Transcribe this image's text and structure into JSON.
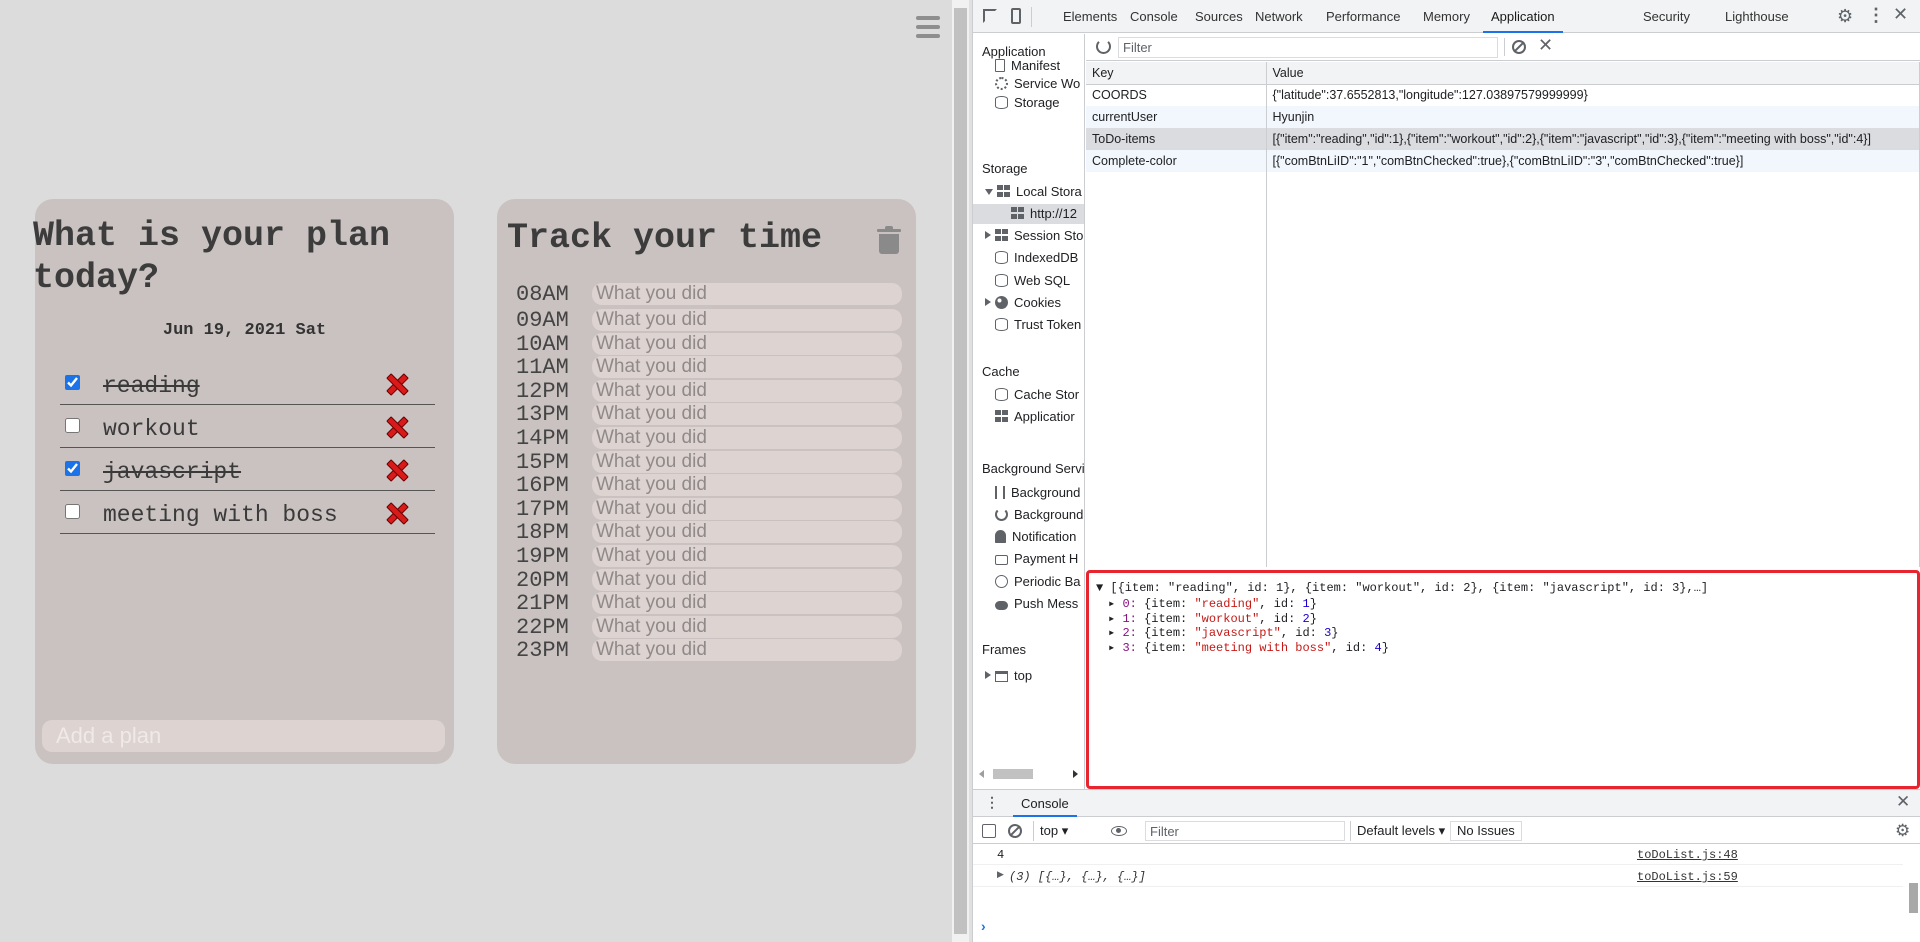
{
  "page": {
    "plan": {
      "title": "What is your plan today?",
      "date": "Jun 19, 2021 Sat",
      "todos": [
        {
          "text": "reading",
          "checked": true
        },
        {
          "text": "workout",
          "checked": false
        },
        {
          "text": "javascript",
          "checked": true
        },
        {
          "text": "meeting with boss",
          "checked": false
        }
      ],
      "add_placeholder": "Add a plan"
    },
    "track": {
      "title": "Track your time",
      "placeholder": "What you did",
      "hours": [
        "08AM",
        "09AM",
        "10AM",
        "11AM",
        "12PM",
        "13PM",
        "14PM",
        "15PM",
        "16PM",
        "17PM",
        "18PM",
        "19PM",
        "20PM",
        "21PM",
        "22PM",
        "23PM"
      ]
    }
  },
  "devtools": {
    "tabs": [
      "Elements",
      "Console",
      "Sources",
      "Network",
      "Performance",
      "Memory",
      "Application",
      "Security",
      "Lighthouse"
    ],
    "active_tab": "Application",
    "sidebar": {
      "application_header": "Application",
      "application_items": [
        "Manifest",
        "Service Wo",
        "Storage"
      ],
      "storage_header": "Storage",
      "local_storage": "Local Stora",
      "local_storage_origin": "http://12",
      "storage_items": [
        "Session Sto",
        "IndexedDB",
        "Web SQL",
        "Cookies",
        "Trust Token"
      ],
      "cache_header": "Cache",
      "cache_items": [
        "Cache Stor",
        "Applicatior"
      ],
      "background_header": "Background Servi",
      "background_items": [
        "Background",
        "Background",
        "Notification",
        "Payment H",
        "Periodic Ba",
        "Push Mess"
      ],
      "frames_header": "Frames",
      "frames_item": "top"
    },
    "filter_placeholder": "Filter",
    "table": {
      "headers": [
        "Key",
        "Value"
      ],
      "rows": [
        {
          "key": "COORDS",
          "value": "{\"latitude\":37.6552813,\"longitude\":127.03897579999999}"
        },
        {
          "key": "currentUser",
          "value": "Hyunjin"
        },
        {
          "key": "ToDo-items",
          "value": "[{\"item\":\"reading\",\"id\":1},{\"item\":\"workout\",\"id\":2},{\"item\":\"javascript\",\"id\":3},{\"item\":\"meeting with boss\",\"id\":4}]"
        },
        {
          "key": "Complete-color",
          "value": "[{\"comBtnLiID\":\"1\",\"comBtnChecked\":true},{\"comBtnLiID\":\"3\",\"comBtnChecked\":true}]"
        }
      ],
      "selected_row": 2
    },
    "preview": {
      "summary": "[{item: \"reading\", id: 1}, {item: \"workout\", id: 2}, {item: \"javascript\", id: 3},…]",
      "entries": [
        {
          "index": "0",
          "item": "\"reading\"",
          "id": "1"
        },
        {
          "index": "1",
          "item": "\"workout\"",
          "id": "2"
        },
        {
          "index": "2",
          "item": "\"javascript\"",
          "id": "3"
        },
        {
          "index": "3",
          "item": "\"meeting with boss\"",
          "id": "4"
        }
      ],
      "highlight_color": "#e8242f"
    },
    "console": {
      "tab_label": "Console",
      "context": "top",
      "filter_placeholder": "Filter",
      "levels": "Default levels",
      "issues": "No Issues",
      "messages": [
        {
          "text": "4",
          "source": "toDoList.js:48",
          "object": false
        },
        {
          "text": "(3) [{…}, {…}, {…}]",
          "source": "toDoList.js:59",
          "object": true
        }
      ]
    }
  }
}
